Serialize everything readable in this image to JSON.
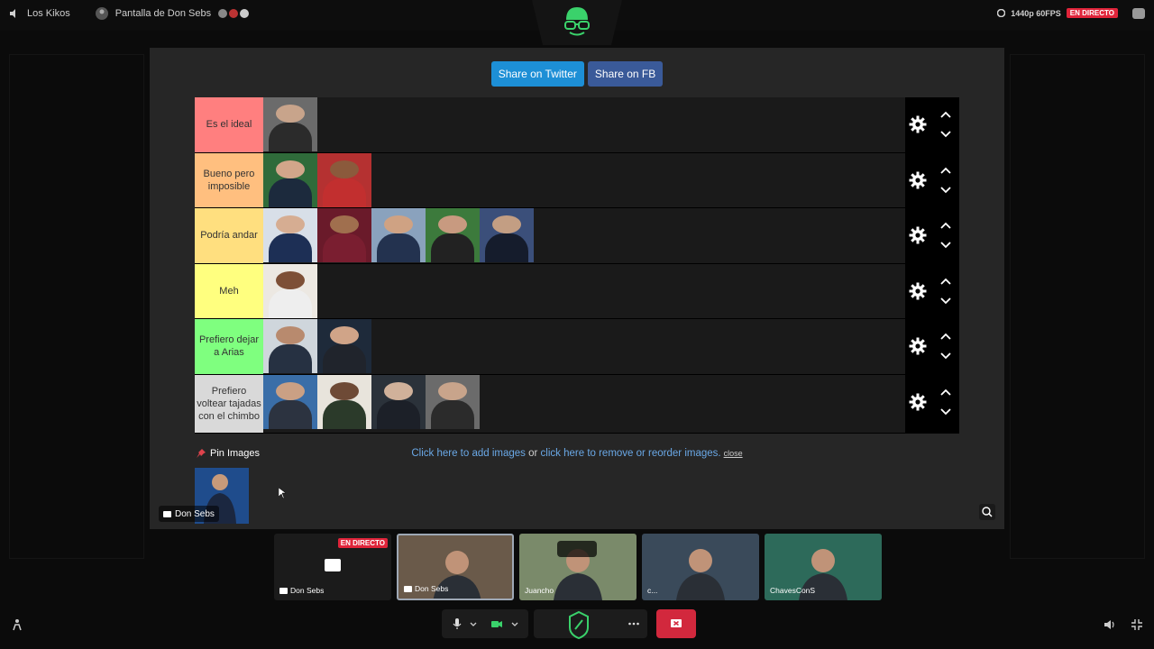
{
  "topbar": {
    "server_name": "Los Kikos",
    "screen_title": "Pantalla de Don Sebs",
    "quality": "1440p 60FPS",
    "live_badge": "EN DIRECTO"
  },
  "share": {
    "twitter_label": "Share on Twitter",
    "fb_label": "Share on FB"
  },
  "tiers": [
    {
      "label": "Es el ideal",
      "color": "#ff7f7f",
      "thumbs": 1
    },
    {
      "label": "Bueno pero imposible",
      "color": "#ffbf7f",
      "thumbs": 2
    },
    {
      "label": "Podría andar",
      "color": "#ffdf7f",
      "thumbs": 5
    },
    {
      "label": "Meh",
      "color": "#ffff7f",
      "thumbs": 1
    },
    {
      "label": "Prefiero dejar a Arias",
      "color": "#7fff7f",
      "thumbs": 2
    },
    {
      "label": "Prefiero voltear tajadas con el chimbo",
      "color": "#d9d9d9",
      "thumbs": 4
    }
  ],
  "editor": {
    "pin_label": "Pin Images",
    "add_link": "Click here to add images",
    "or_text": " or ",
    "remove_link": "click here to remove or reorder images.",
    "close_label": "close"
  },
  "stage_name_tag": "Don Sebs",
  "participants": [
    {
      "name": "Don Sebs",
      "live": "EN DIRECTO"
    },
    {
      "name": "Don Sebs"
    },
    {
      "name": "Juancho"
    },
    {
      "name": "c..."
    },
    {
      "name": "ChavesConS"
    }
  ],
  "colors": {
    "twitter": "#1d8fd6",
    "facebook": "#3a5a99",
    "live": "#e0243a",
    "accent_green": "#3ad26b"
  }
}
